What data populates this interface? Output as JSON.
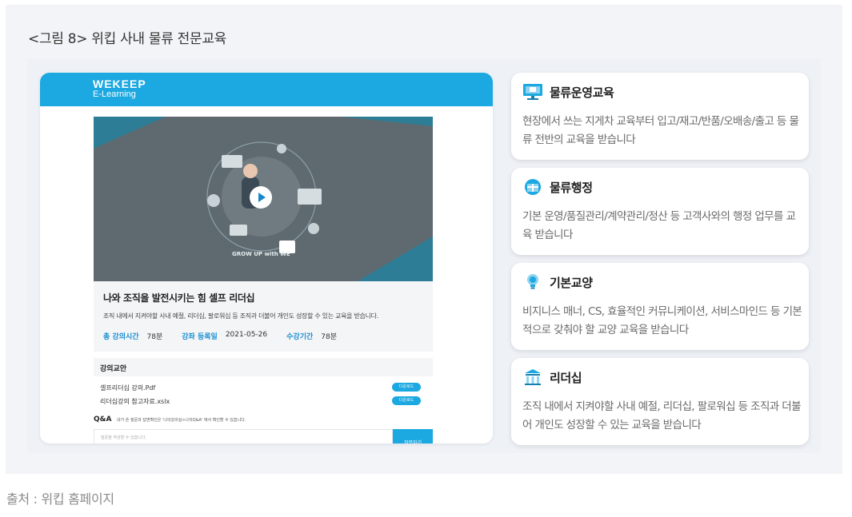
{
  "figure": {
    "title": "<그림 8> 위킵 사내 물류 전문교육",
    "source": "출처 : 위킵 홈페이지"
  },
  "screenshot": {
    "brand": "WEKEEP",
    "brand_sub": "E-Learning",
    "video_badge": "GROW UP with WE",
    "course_title": "나와 조직을 발전시키는 힘 셀프 리더십",
    "course_desc": "조직 내에서 지켜야할 사내 예절, 리더십, 팔로워십 등 조직과 더불어 개인도 성장할 수 있는 교육을 받습니다.",
    "meta": [
      {
        "label": "총 강의시간",
        "value": "78분"
      },
      {
        "label": "강좌 등록일",
        "value": "2021-05-26"
      },
      {
        "label": "수강기간",
        "value": "78분"
      }
    ],
    "materials_heading": "강의교안",
    "materials": [
      {
        "name": "셀프리더십 강의.Pdf",
        "button": "다운로드"
      },
      {
        "name": "리더십강의 참고자료.xslx",
        "button": "다운로드"
      }
    ],
    "qa_label": "Q&A",
    "qa_note": "내가 쓴 질문과 답변확인은 '나의강의실>나의Q&A' 에서 확인할 수 있습니다.",
    "qa_placeholder": "질문을 작성할 수 있습니다.",
    "qa_submit": "질문하기"
  },
  "cards": [
    {
      "icon": "monitor-icon",
      "title": "물류운영교육",
      "desc": "현장에서 쓰는 지게차 교육부터 입고/재고/반품/오배송/출고 등 물류 전반의 교육을 받습니다"
    },
    {
      "icon": "globe-box-icon",
      "title": "물류행정",
      "desc": "기본 운영/품질관리/계약관리/정산 등 고객사와의 행정 업무를 교육 받습니다"
    },
    {
      "icon": "lightbulb-icon",
      "title": "기본교양",
      "desc": "비지니스 매너, CS, 효율적인 커뮤니케이션, 서비스마인드 등 기본적으로 갖춰야 할 교양 교육을 받습니다"
    },
    {
      "icon": "building-icon",
      "title": "리더십",
      "desc": "조직 내에서 지켜야할 사내 예절, 리더십, 팔로워십 등 조직과 더불어 개인도 성장할 수 있는 교육을 받습니다"
    }
  ],
  "colors": {
    "accent": "#1ca8e0",
    "meta_label": "#1a8fd0"
  }
}
